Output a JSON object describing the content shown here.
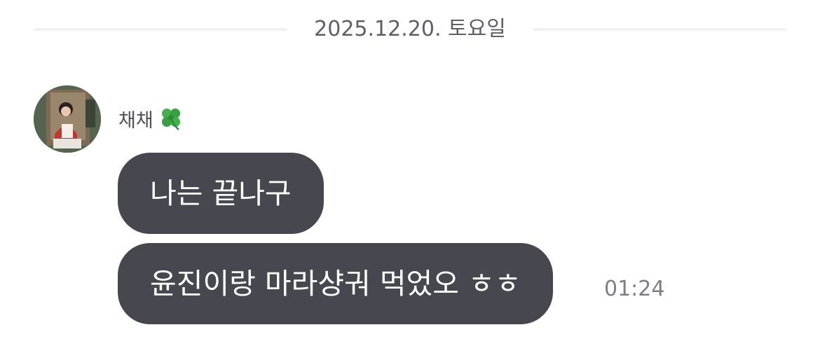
{
  "chat": {
    "date_divider": "2025.12.20. 토요일",
    "sender": {
      "name": "채채",
      "emoji_icon": "four-leaf-clover-icon"
    },
    "messages": [
      {
        "text": "나는 끝나구",
        "time": ""
      },
      {
        "text": "윤진이랑 마라샹궈 먹었오 ㅎㅎ",
        "time": "01:24"
      }
    ]
  },
  "colors": {
    "bubble_bg": "#46474f",
    "bubble_text": "#ffffff",
    "date_text": "#5f6066",
    "divider_line": "#f1f1f3",
    "time_text": "#7d7e84",
    "clover_green": "#3fae49"
  }
}
